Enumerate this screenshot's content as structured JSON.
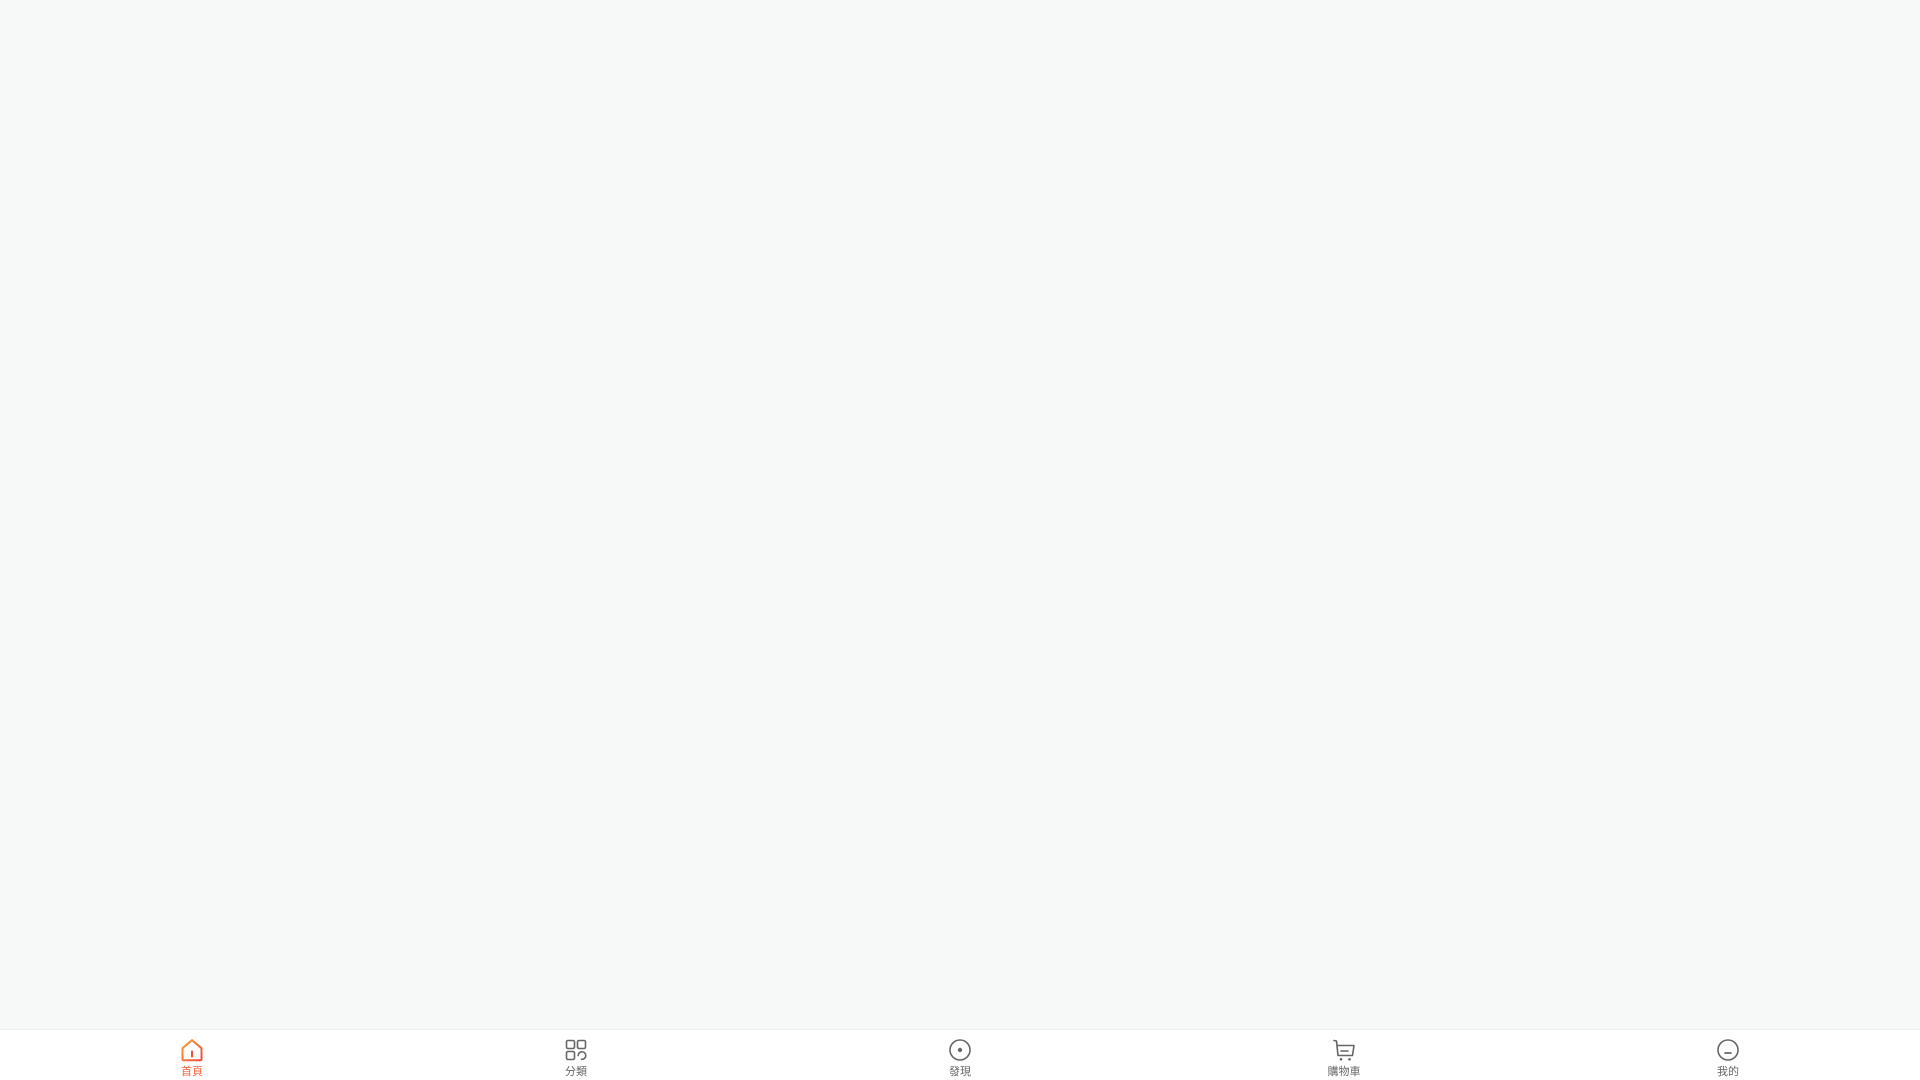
{
  "colors": {
    "background": "#f7f8f8",
    "tabbar_background": "#ffffff",
    "active": "#f2643c",
    "inactive": "#666666"
  },
  "tabbar": {
    "active_tab": "home",
    "tabs": [
      {
        "id": "home",
        "label": "首頁",
        "icon": "home-icon"
      },
      {
        "id": "category",
        "label": "分類",
        "icon": "grid-icon"
      },
      {
        "id": "discover",
        "label": "發現",
        "icon": "compass-icon"
      },
      {
        "id": "cart",
        "label": "購物車",
        "icon": "cart-icon"
      },
      {
        "id": "mine",
        "label": "我的",
        "icon": "face-icon"
      }
    ]
  }
}
